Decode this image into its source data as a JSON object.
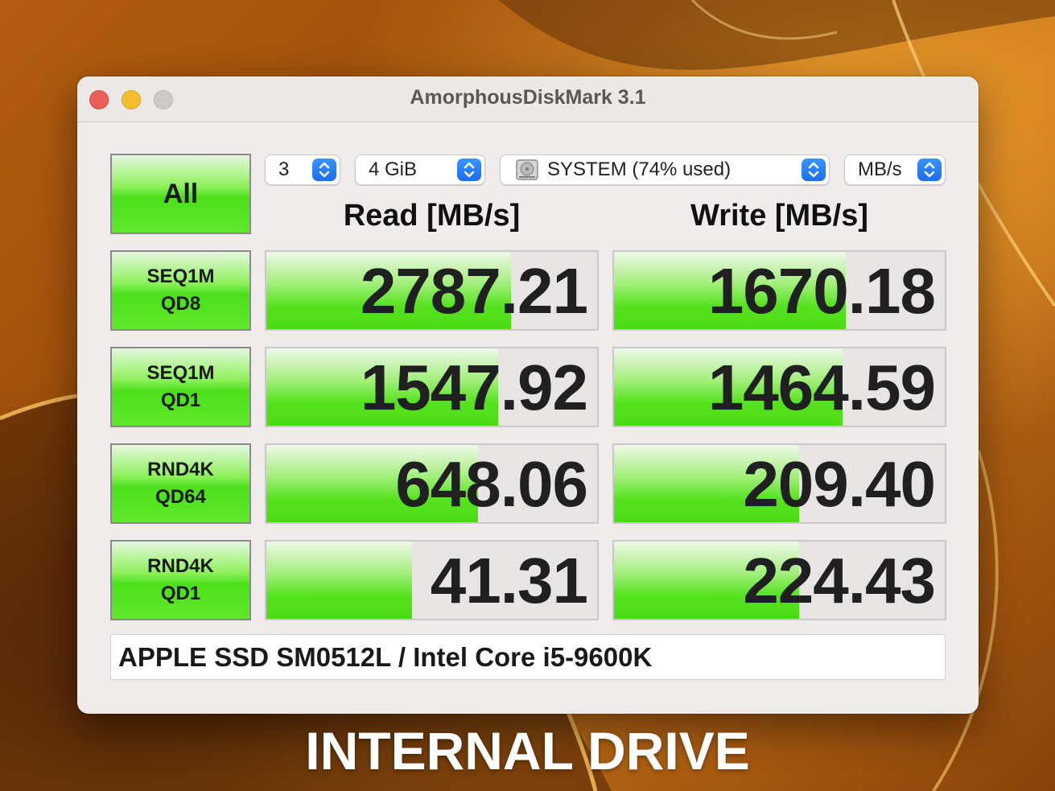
{
  "window": {
    "title": "AmorphousDiskMark 3.1"
  },
  "controls": {
    "all_button": "All",
    "count": "3",
    "size": "4 GiB",
    "drive": "SYSTEM (74% used)",
    "unit": "MB/s"
  },
  "headers": {
    "read": "Read [MB/s]",
    "write": "Write [MB/s]"
  },
  "tests": [
    {
      "line1": "SEQ1M",
      "line2": "QD8",
      "read": "2787.21",
      "write": "1670.18",
      "read_fill": 0.74,
      "write_fill": 0.7
    },
    {
      "line1": "SEQ1M",
      "line2": "QD1",
      "read": "1547.92",
      "write": "1464.59",
      "read_fill": 0.7,
      "write_fill": 0.69
    },
    {
      "line1": "RND4K",
      "line2": "QD64",
      "read": "648.06",
      "write": "209.40",
      "read_fill": 0.64,
      "write_fill": 0.56
    },
    {
      "line1": "RND4K",
      "line2": "QD1",
      "read": "41.31",
      "write": "224.43",
      "read_fill": 0.44,
      "write_fill": 0.56
    }
  ],
  "info": "APPLE SSD SM0512L / Intel Core i5-9600K",
  "caption": "INTERNAL DRIVE",
  "colors": {
    "bar_green": "#4be01a",
    "accent_blue": "#1a6cf0",
    "wallpaper": "#b25e10"
  },
  "icons": {
    "drive": "hard-drive-icon",
    "stepper": "up-down-chevron-icon"
  }
}
